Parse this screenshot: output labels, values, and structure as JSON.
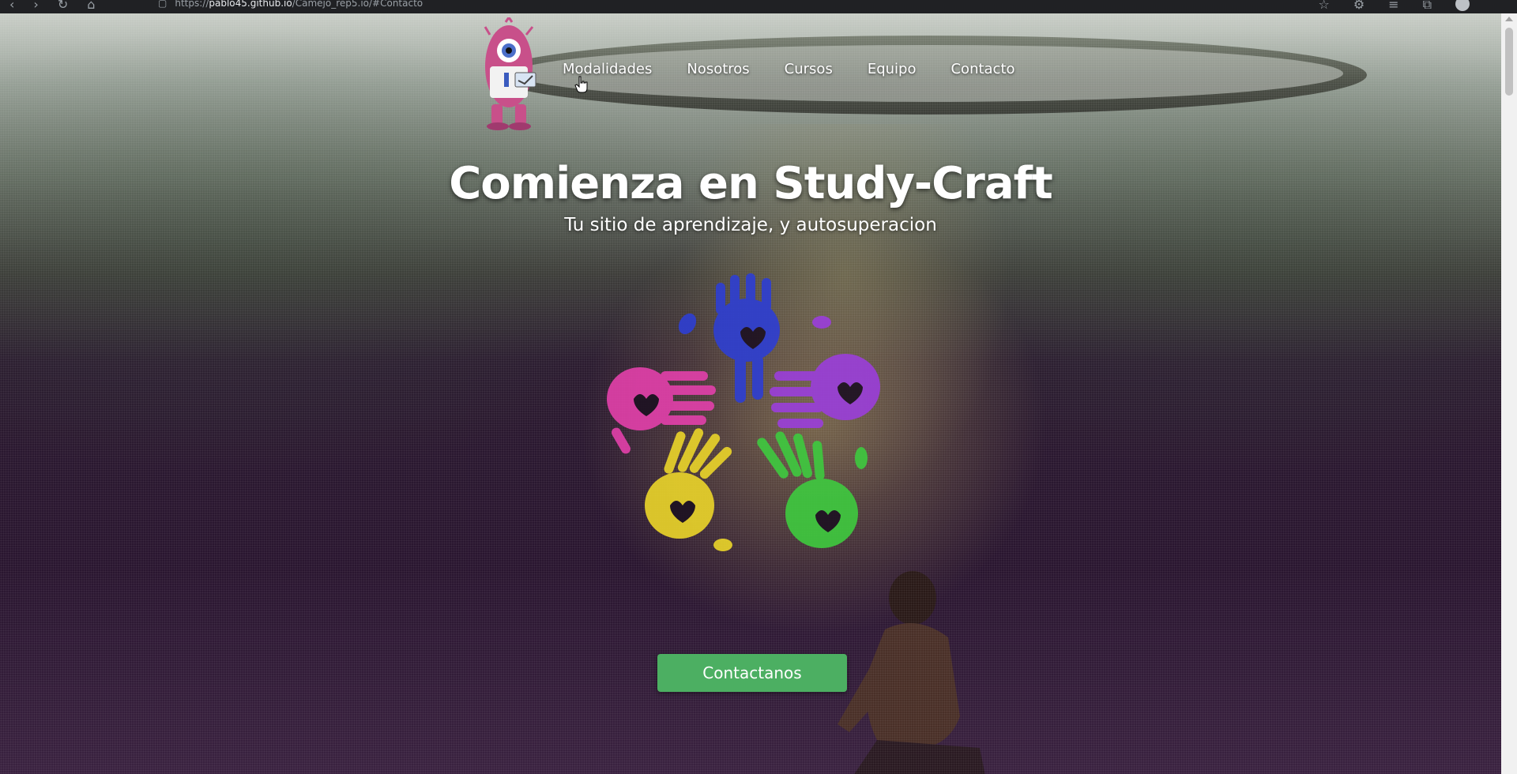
{
  "browser": {
    "url_prefix": "https://",
    "url_host": "pablo45.github.io",
    "url_path": "/Camejo_rep5.io/#Contacto"
  },
  "nav": {
    "items": [
      {
        "label": "Modalidades"
      },
      {
        "label": "Nosotros"
      },
      {
        "label": "Cursos"
      },
      {
        "label": "Equipo"
      },
      {
        "label": "Contacto"
      }
    ]
  },
  "hero": {
    "title": "Comienza en Study-Craft",
    "subtitle": "Tu sitio de aprendizaje, y autosuperacion",
    "cta_label": "Contactanos"
  },
  "colors": {
    "cta": "#4caf62",
    "hand_blue": "#2f3fd0",
    "hand_pink": "#e040a8",
    "hand_purple": "#9a3fd8",
    "hand_yellow": "#e8d22a",
    "hand_green": "#3fc83f",
    "logo_monster": "#c8508a"
  },
  "icons": {
    "logo": "pink-monster-mascot",
    "emblem": "five-colored-handprints",
    "cursor": "hand-pointer-cursor"
  }
}
